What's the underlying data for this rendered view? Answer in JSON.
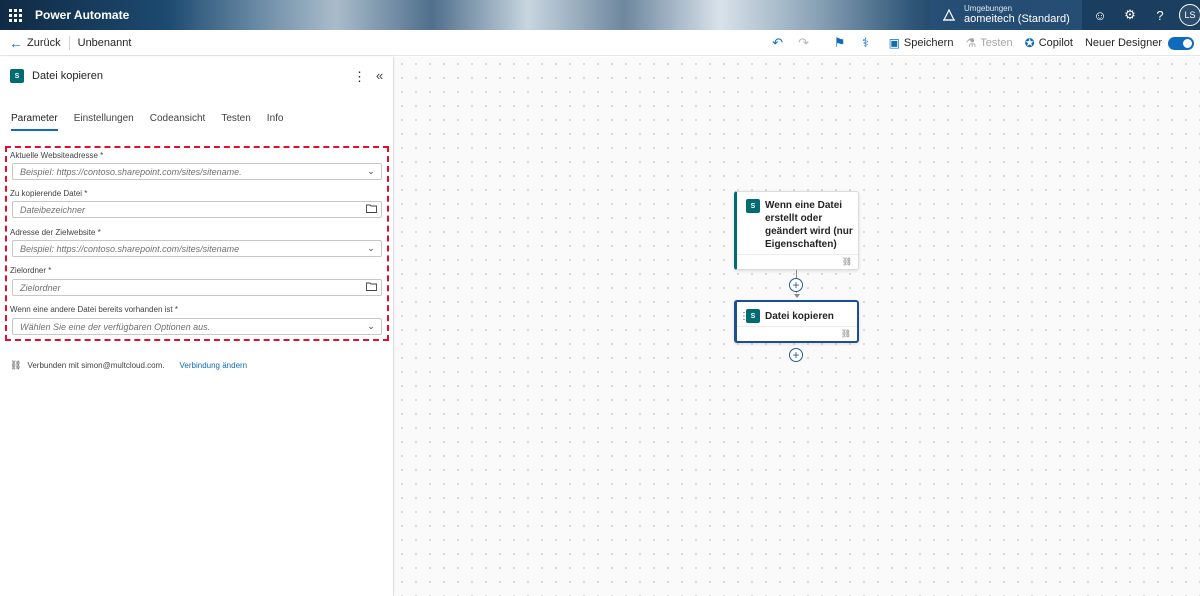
{
  "header": {
    "app_name": "Power Automate",
    "environment_label": "Umgebungen",
    "environment_name": "aomeitech (Standard)",
    "avatar_initials": "LS"
  },
  "toolbar": {
    "back_label": "Zurück",
    "flow_name": "Unbenannt",
    "save_label": "Speichern",
    "test_label": "Testen",
    "copilot_label": "Copilot",
    "new_designer_label": "Neuer Designer",
    "new_designer_on": true
  },
  "panel": {
    "title": "Datei kopieren",
    "tabs": [
      {
        "label": "Parameter",
        "active": true
      },
      {
        "label": "Einstellungen",
        "active": false
      },
      {
        "label": "Codeansicht",
        "active": false
      },
      {
        "label": "Testen",
        "active": false
      },
      {
        "label": "Info",
        "active": false
      }
    ],
    "fields": [
      {
        "label": "Aktuelle Websiteadresse *",
        "placeholder": "Beispiel: https://contoso.sharepoint.com/sites/sitename.",
        "icon": "chevron-down-icon"
      },
      {
        "label": "Zu kopierende Datei *",
        "placeholder": "Dateibezeichner",
        "icon": "folder-icon"
      },
      {
        "label": "Adresse der Zielwebsite *",
        "placeholder": "Beispiel: https://contoso.sharepoint.com/sites/sitename",
        "icon": "chevron-down-icon"
      },
      {
        "label": "Zielordner *",
        "placeholder": "Zielordner",
        "icon": "folder-icon"
      },
      {
        "label": "Wenn eine andere Datei bereits vorhanden ist *",
        "placeholder": "Wählen Sie eine der verfügbaren Optionen aus.",
        "icon": "chevron-down-icon"
      }
    ],
    "connected_text": "Verbunden mit simon@multcloud.com.",
    "change_connection": "Verbindung ändern"
  },
  "canvas": {
    "trigger_card_title": "Wenn eine Datei erstellt oder geändert wird (nur Eigenschaften)",
    "action_card_title": "Datei kopieren"
  },
  "colors": {
    "accent": "#0f6cbd",
    "sharepoint": "#036c70",
    "highlight_border": "#e0102c"
  }
}
